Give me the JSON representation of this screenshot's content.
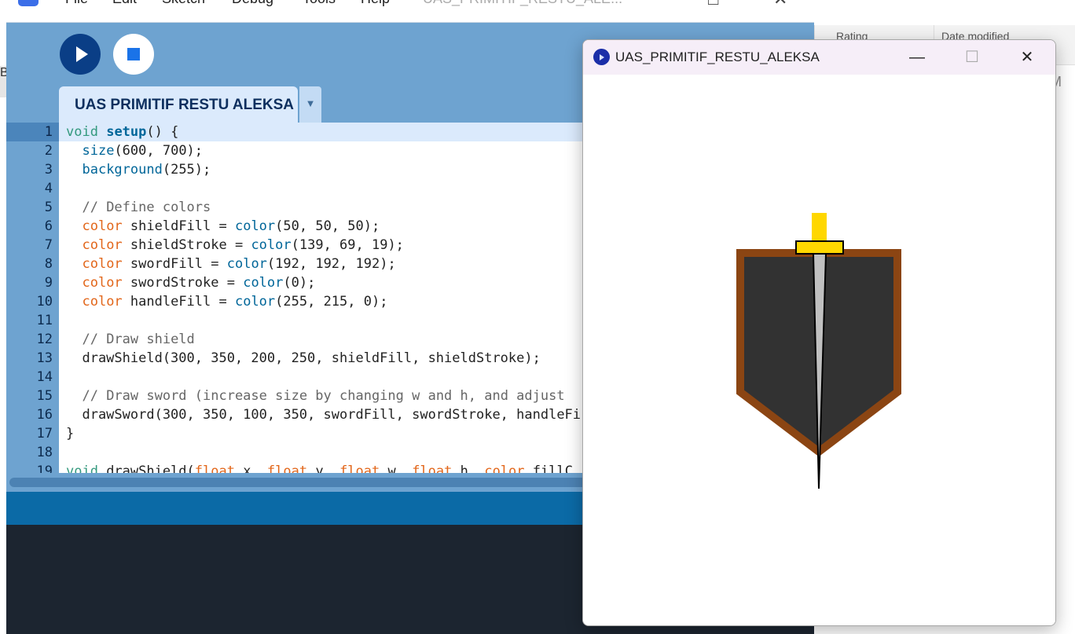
{
  "menu": {
    "items": [
      "File",
      "Edit",
      "Sketch",
      "Debug",
      "Tools",
      "Help"
    ],
    "truncated_title": "UAS_PRIMITIF_RESTU_ALE..."
  },
  "background_window": {
    "col1": "Rating",
    "col2": "Date modified",
    "letter_right": "M",
    "letter_left": "B"
  },
  "editor_tab": {
    "label": "UAS PRIMITIF RESTU ALEKSA"
  },
  "code_lines": [
    "1",
    "2",
    "3",
    "4",
    "5",
    "6",
    "7",
    "8",
    "9",
    "10",
    "11",
    "12",
    "13",
    "14",
    "15",
    "16",
    "17",
    "18",
    "19"
  ],
  "sketch_window": {
    "title": "UAS_PRIMITIF_RESTU_ALEKSA",
    "minimize_icon": "minimize-icon",
    "maximize_icon": "maximize-icon",
    "close_icon": "close-icon"
  },
  "colors": {
    "shield_fill": "#323232",
    "shield_stroke": "#8b4513",
    "sword_fill": "#c0c0c0",
    "sword_stroke": "#000000",
    "handle_fill": "#ffd700",
    "ide_accent": "#6ea3d0"
  }
}
